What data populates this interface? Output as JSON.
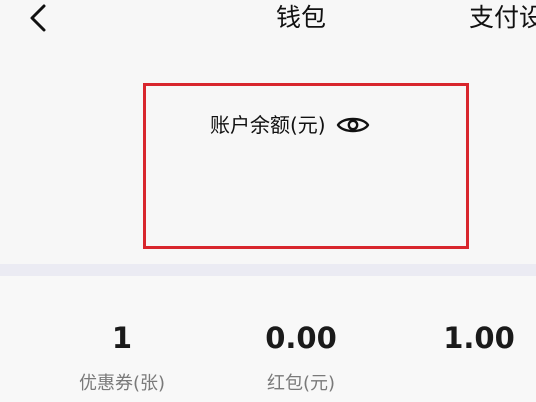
{
  "header": {
    "title": "钱包",
    "right_link": "支付设"
  },
  "balance": {
    "label": "账户余额(元)",
    "toggle_icon": "eye-icon",
    "highlight_color": "#d8262d"
  },
  "stats": [
    {
      "value": "1",
      "label": "优惠券(张)"
    },
    {
      "value": "0.00",
      "label": "红包(元)"
    },
    {
      "value": "1.00",
      "label": ""
    }
  ]
}
